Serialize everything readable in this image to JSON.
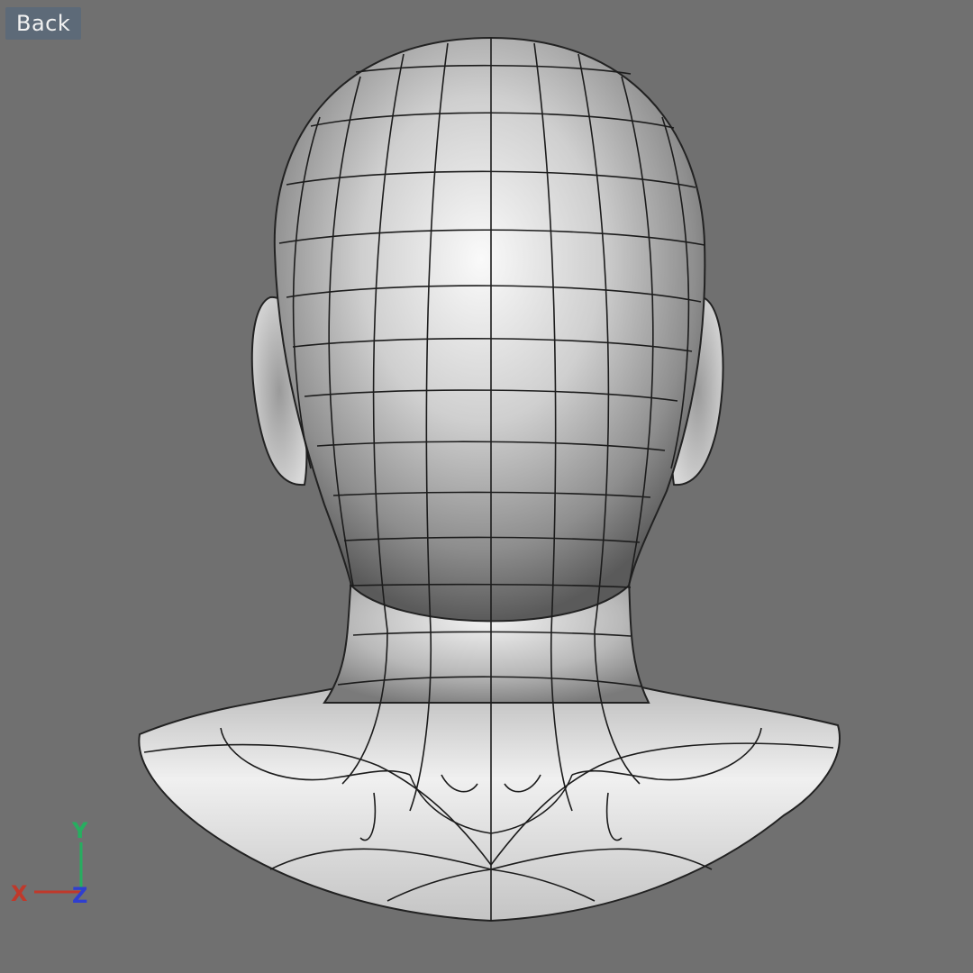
{
  "viewport": {
    "view_label": "Back",
    "background_color": "#707070"
  },
  "axis_gizmo": {
    "x_label": "X",
    "y_label": "Y",
    "z_label": "Z",
    "x_color": "#c0392b",
    "y_color": "#27ae60",
    "z_color": "#2f3fd0"
  },
  "model": {
    "icon": "head-mesh-wireframe",
    "shading": "smooth-gray-with-wire-overlay"
  }
}
